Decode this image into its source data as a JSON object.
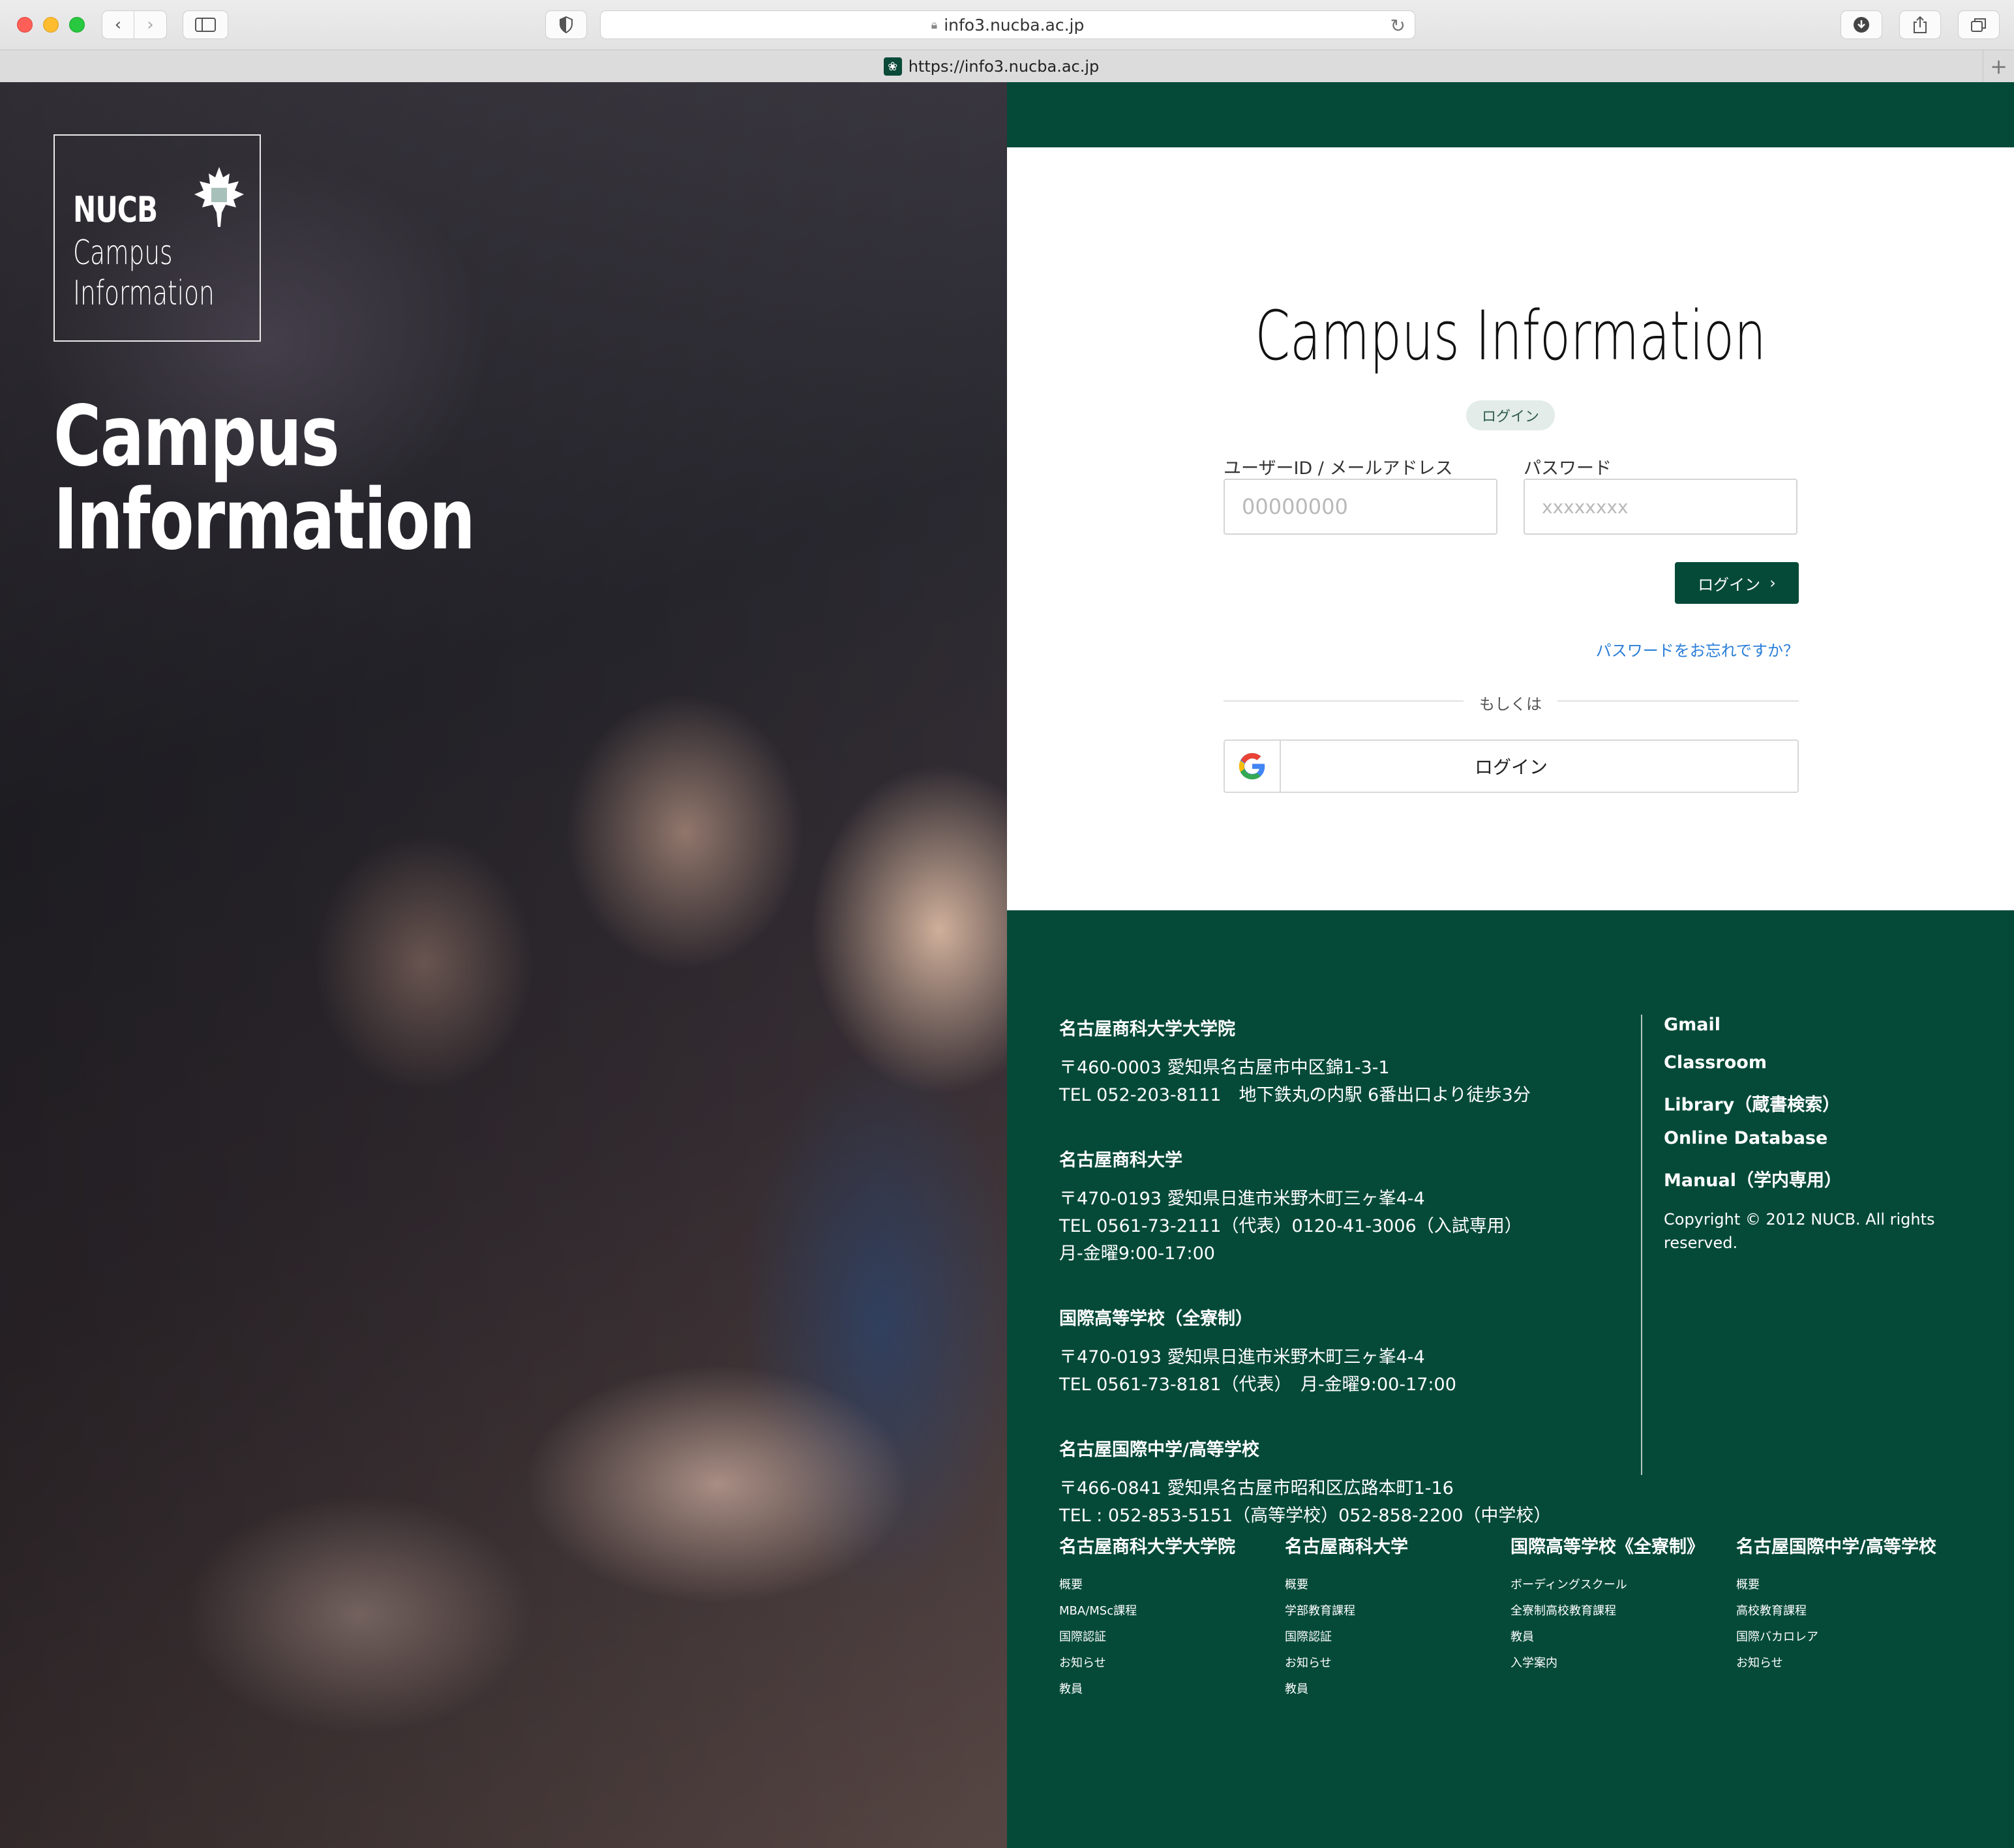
{
  "browser": {
    "url_display": "info3.nucba.ac.jp",
    "tab_title": "https://info3.nucba.ac.jp"
  },
  "hero": {
    "logo_nucb": "NUCB",
    "logo_line1": "Campus",
    "logo_line2": "Information",
    "title_line1": "Campus",
    "title_line2": "Information"
  },
  "login": {
    "title": "Campus Information",
    "badge": "ログイン",
    "user_label": "ユーザーID / メールアドレス",
    "user_placeholder": "00000000",
    "pass_label": "パスワード",
    "pass_placeholder": "xxxxxxxx",
    "submit_label": "ログイン",
    "forgot_label": "パスワードをお忘れですか？",
    "or_label": "もしくは",
    "google_label": "ログイン"
  },
  "footer": {
    "addresses": [
      {
        "name": "名古屋商科大学大学院",
        "lines": [
          "〒460-0003 愛知県名古屋市中区錦1-3-1",
          "TEL 052-203-8111　地下鉄丸の内駅 6番出口より徒歩3分"
        ]
      },
      {
        "name": "名古屋商科大学",
        "lines": [
          "〒470-0193 愛知県日進市米野木町三ヶ峯4-4",
          "TEL 0561-73-2111（代表）0120-41-3006（入試専用）",
          "月-金曜9:00-17:00"
        ]
      },
      {
        "name": "国際高等学校（全寮制）",
        "lines": [
          "〒470-0193 愛知県日進市米野木町三ヶ峯4-4",
          "TEL 0561-73-8181（代表）　月-金曜9:00-17:00"
        ]
      },
      {
        "name": "名古屋国際中学/高等学校",
        "lines": [
          "〒466-0841 愛知県名古屋市昭和区広路本町1-16",
          "TEL : 052-853-5151（高等学校）052-858-2200（中学校）"
        ]
      }
    ],
    "links": [
      "Gmail",
      "Classroom",
      "Library（蔵書検索）",
      "Online Database",
      "Manual（学内専用）"
    ],
    "copyright": "Copyright © 2012 NUCB. All rights reserved.",
    "sitemap": [
      {
        "title": "名古屋商科大学大学院",
        "items": [
          "概要",
          "MBA/MSc課程",
          "国際認証",
          "お知らせ",
          "教員"
        ]
      },
      {
        "title": "名古屋商科大学",
        "items": [
          "概要",
          "学部教育課程",
          "国際認証",
          "お知らせ",
          "教員"
        ]
      },
      {
        "title": "国際高等学校《全寮制》",
        "items": [
          "ボーディングスクール",
          "全寮制高校教育課程",
          "教員",
          "入学案内"
        ]
      },
      {
        "title": "名古屋国際中学/高等学校",
        "items": [
          "概要",
          "高校教育課程",
          "国際バカロレア",
          "お知らせ"
        ]
      }
    ]
  }
}
